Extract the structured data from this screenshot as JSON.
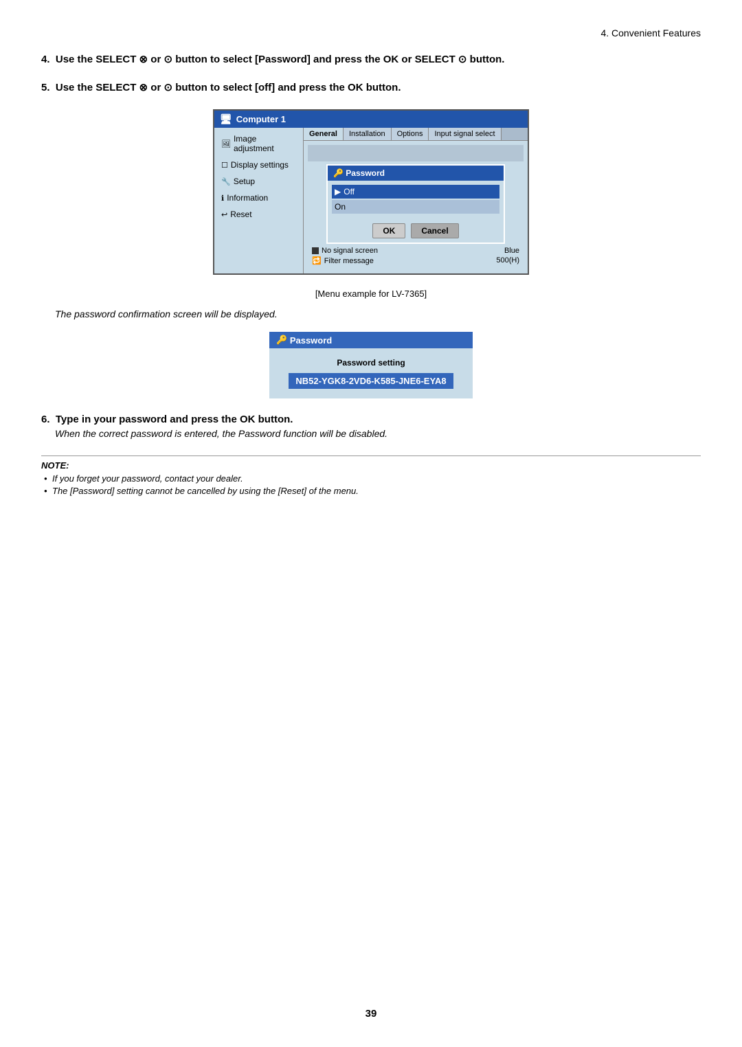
{
  "page": {
    "header": "4. Convenient Features",
    "page_number": "39"
  },
  "steps": {
    "step4": {
      "text": "4.  Use the SELECT ⊗ or ⊙ button to select [Password] and press the OK or SELECT ⊙ button."
    },
    "step5": {
      "text": "5.  Use the SELECT ⊗ or ⊙ button to select [off] and press the OK button."
    },
    "step6": {
      "text": "6.  Type in your password and press the OK button.",
      "sub": "When the correct password is entered, the Password function will be disabled."
    }
  },
  "ui_menu": {
    "title": "Computer 1",
    "sidebar": [
      {
        "label": "Image adjustment",
        "icon": "🖼",
        "active": false
      },
      {
        "label": "Display settings",
        "icon": "🖥",
        "active": false
      },
      {
        "label": "Setup",
        "icon": "🔧",
        "active": false
      },
      {
        "label": "Information",
        "icon": "ℹ",
        "active": false
      },
      {
        "label": "Reset",
        "icon": "↩",
        "active": false
      }
    ],
    "tabs": [
      "General",
      "Installation",
      "Options",
      "Input signal select"
    ],
    "dialog": {
      "title": "Password",
      "title_icon": "🔑",
      "off_label": "Off",
      "on_label": "On",
      "ok_label": "OK",
      "cancel_label": "Cancel"
    },
    "footer_rows": [
      {
        "label": "No signal screen",
        "value": "Blue"
      },
      {
        "label": "Filter message",
        "value": "500(H)"
      }
    ],
    "caption": "[Menu example for LV-7365]"
  },
  "password_confirm": {
    "title": "Password",
    "title_icon": "🔑",
    "setting_label": "Password setting",
    "key": "NB52-YGK8-2VD6-K585-JNE6-EYA8"
  },
  "note": {
    "title": "NOTE:",
    "items": [
      "If you forget your password, contact your dealer.",
      "The [Password] setting cannot be cancelled by using the [Reset] of the menu."
    ]
  },
  "confirm_text": "The password confirmation screen will be displayed."
}
